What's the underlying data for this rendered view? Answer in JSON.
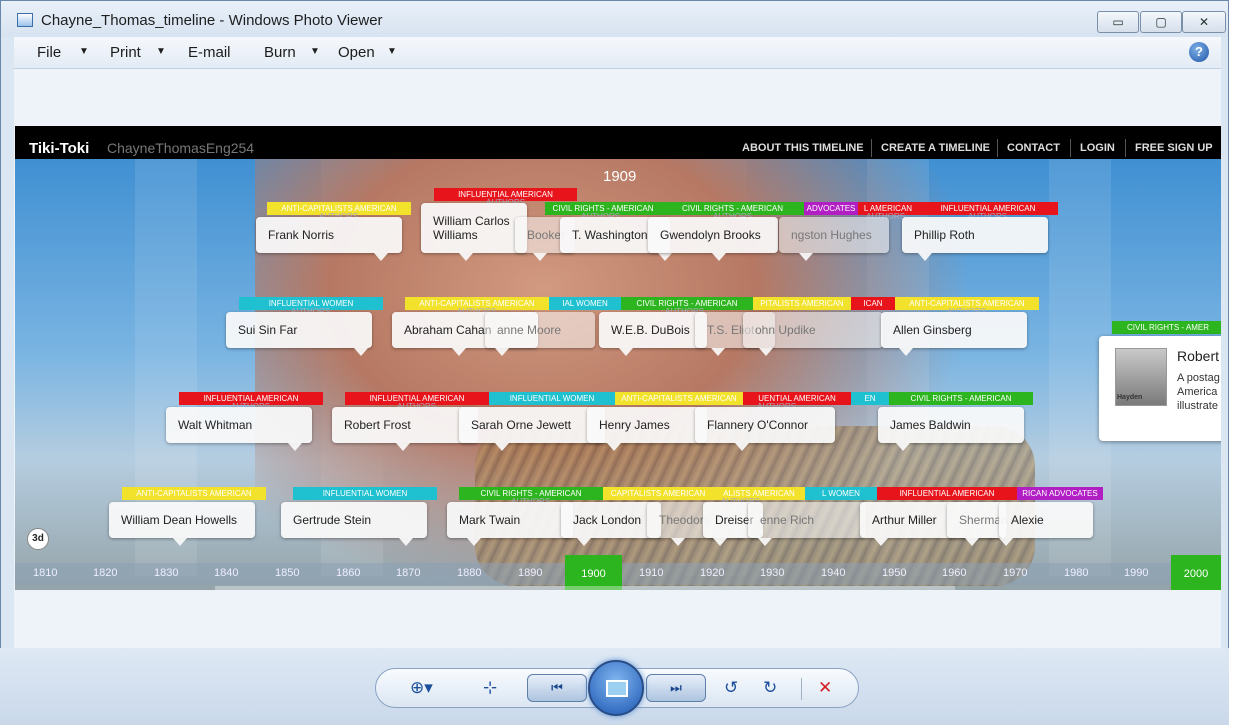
{
  "window": {
    "title": "Chayne_Thomas_timeline - Windows Photo Viewer",
    "minimize": "▭",
    "maximize": "▢",
    "close": "✕"
  },
  "menu": {
    "file": "File",
    "print": "Print",
    "email": "E-mail",
    "burn": "Burn",
    "open": "Open",
    "caret": "▼",
    "help": "?"
  },
  "timeline": {
    "brand": "Tiki-Toki",
    "author": "ChayneThomasEng254",
    "nav": [
      "ABOUT THIS TIMELINE",
      "CREATE A TIMELINE",
      "CONTACT",
      "LOGIN",
      "FREE SIGN UP"
    ],
    "year": "1909",
    "mode": "3d",
    "ticks": [
      "1810",
      "1820",
      "1830",
      "1840",
      "1850",
      "1860",
      "1870",
      "1880",
      "1890",
      "1900",
      "1910",
      "1920",
      "1930",
      "1940",
      "1950",
      "1960",
      "1970",
      "1980",
      "1990",
      "2000"
    ],
    "tags": [
      "ANTI-CAPITALISTS AMERICAN",
      "INFLUENTIAL AMERICAN",
      "CIVIL RIGHTS - AMERICAN",
      "CIVIL RIGHTS - AMERICAN",
      "ADVOCATES",
      "L AMERICAN",
      "INFLUENTIAL AMERICAN",
      "INFLUENTIAL WOMEN",
      "ANTI-CAPITALISTS AMERICAN",
      "IAL WOMEN",
      "CIVIL RIGHTS - AMERICAN",
      "PITALISTS AMERICAN",
      "ICAN",
      "ANTI-CAPITALISTS AMERICAN",
      "INFLUENTIAL AMERICAN",
      "INFLUENTIAL AMERICAN",
      "INFLUENTIAL WOMEN",
      "ANTI-CAPITALISTS AMERICAN",
      "UENTIAL AMERICAN",
      "EN",
      "CIVIL RIGHTS - AMERICAN",
      "ANTI-CAPITALISTS AMERICAN",
      "INFLUENTIAL WOMEN",
      "CIVIL RIGHTS - AMERICAN",
      "CAPITALISTS AMERICAN",
      "ALISTS AMERICAN",
      "L WOMEN",
      "INFLUENTIAL AMERICAN",
      "RICAN ADVOCATES",
      "CIVIL RIGHTS - AMER"
    ],
    "subs": [
      "AUTHORS",
      "AUTHORS",
      "AUTHORS",
      "AUTHORS",
      "AUTHORS",
      "AUTHORS",
      "AUTHORS",
      "AUTHORS",
      "AUTHORS",
      "AUTHORS",
      "AUTHORS",
      "AUTHORS",
      "AUTHORS",
      "AUTHORS",
      "AUTHORS"
    ],
    "cards": [
      "Frank Norris",
      "William Carlos",
      "Williams",
      "Booker",
      "T. Washington",
      "Gwendolyn Brooks",
      "ngston Hughes",
      "Phillip Roth",
      "Sui Sin Far",
      "Abraham Cahan",
      "anne Moore",
      "W.E.B. DuBois",
      "T.S. Eliot",
      "ohn Updike",
      "Allen Ginsberg",
      "Walt Whitman",
      "Robert Frost",
      "Sarah Orne Jewett",
      "Henry James",
      "Flannery O'Connor",
      "James Baldwin",
      "William Dean Howells",
      "Gertrude Stein",
      "Mark Twain",
      "Jack London",
      "Theodore",
      "Dreiser",
      "enne Rich",
      "Arthur Miller",
      "Sherman",
      "Alexie"
    ],
    "feature": {
      "title": "Robert",
      "photo_caption": "Hayden",
      "lines": [
        "A postag",
        "America",
        "illustrate"
      ]
    }
  },
  "toolbar": {
    "zoom": "⊕▾",
    "fit": "⊹",
    "prev": "⏮",
    "next": "⏭",
    "rot_left": "↺",
    "rot_right": "↻",
    "delete": "✕"
  }
}
